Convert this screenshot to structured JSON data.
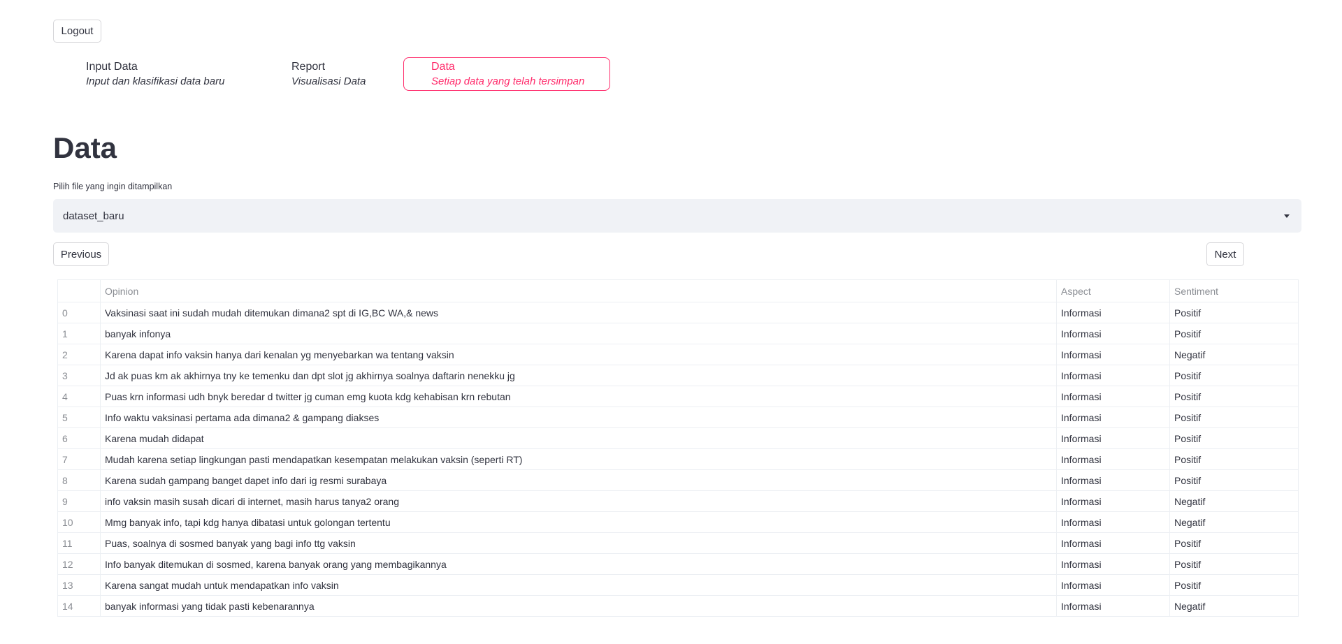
{
  "header": {
    "logout_label": "Logout"
  },
  "nav": [
    {
      "title": "Input Data",
      "subtitle": "Input dan klasifikasi data baru",
      "active": false
    },
    {
      "title": "Report",
      "subtitle": "Visualisasi Data",
      "active": false
    },
    {
      "title": "Data",
      "subtitle": "Setiap data yang telah tersimpan",
      "active": true
    }
  ],
  "page": {
    "title": "Data"
  },
  "file_select": {
    "label": "Pilih file yang ingin ditampilkan",
    "value": "dataset_baru"
  },
  "pagination": {
    "previous_label": "Previous",
    "next_label": "Next"
  },
  "table": {
    "columns": [
      "",
      "Opinion",
      "Aspect",
      "Sentiment"
    ],
    "rows": [
      {
        "index": "0",
        "opinion": "Vaksinasi saat ini sudah mudah ditemukan dimana2 spt di IG,BC WA,& news",
        "aspect": "Informasi",
        "sentiment": "Positif"
      },
      {
        "index": "1",
        "opinion": "banyak infonya",
        "aspect": "Informasi",
        "sentiment": "Positif"
      },
      {
        "index": "2",
        "opinion": "Karena dapat info vaksin hanya dari kenalan yg menyebarkan wa tentang vaksin",
        "aspect": "Informasi",
        "sentiment": "Negatif"
      },
      {
        "index": "3",
        "opinion": "Jd ak puas km ak akhirnya tny ke temenku dan dpt slot jg akhirnya soalnya daftarin nenekku jg",
        "aspect": "Informasi",
        "sentiment": "Positif"
      },
      {
        "index": "4",
        "opinion": "Puas krn informasi udh bnyk beredar d twitter jg cuman emg kuota kdg kehabisan krn rebutan",
        "aspect": "Informasi",
        "sentiment": "Positif"
      },
      {
        "index": "5",
        "opinion": "Info waktu vaksinasi pertama ada dimana2 & gampang diakses",
        "aspect": "Informasi",
        "sentiment": "Positif"
      },
      {
        "index": "6",
        "opinion": "Karena mudah didapat",
        "aspect": "Informasi",
        "sentiment": "Positif"
      },
      {
        "index": "7",
        "opinion": "Mudah karena setiap lingkungan pasti mendapatkan kesempatan melakukan vaksin (seperti RT)",
        "aspect": "Informasi",
        "sentiment": "Positif"
      },
      {
        "index": "8",
        "opinion": "Karena sudah gampang banget dapet info dari ig resmi surabaya",
        "aspect": "Informasi",
        "sentiment": "Positif"
      },
      {
        "index": "9",
        "opinion": "info vaksin masih susah dicari di internet, masih harus tanya2 orang",
        "aspect": "Informasi",
        "sentiment": "Negatif"
      },
      {
        "index": "10",
        "opinion": "Mmg banyak info, tapi kdg hanya dibatasi untuk golongan tertentu",
        "aspect": "Informasi",
        "sentiment": "Negatif"
      },
      {
        "index": "11",
        "opinion": "Puas, soalnya di sosmed banyak yang bagi info ttg vaksin",
        "aspect": "Informasi",
        "sentiment": "Positif"
      },
      {
        "index": "12",
        "opinion": "Info banyak ditemukan di sosmed, karena banyak orang yang membagikannya",
        "aspect": "Informasi",
        "sentiment": "Positif"
      },
      {
        "index": "13",
        "opinion": "Karena sangat mudah untuk mendapatkan info vaksin",
        "aspect": "Informasi",
        "sentiment": "Positif"
      },
      {
        "index": "14",
        "opinion": "banyak informasi yang tidak pasti kebenarannya",
        "aspect": "Informasi",
        "sentiment": "Negatif"
      }
    ]
  },
  "colors": {
    "accent": "#ff2b6b",
    "text": "#31333f",
    "select_bg": "#f0f2f6"
  }
}
